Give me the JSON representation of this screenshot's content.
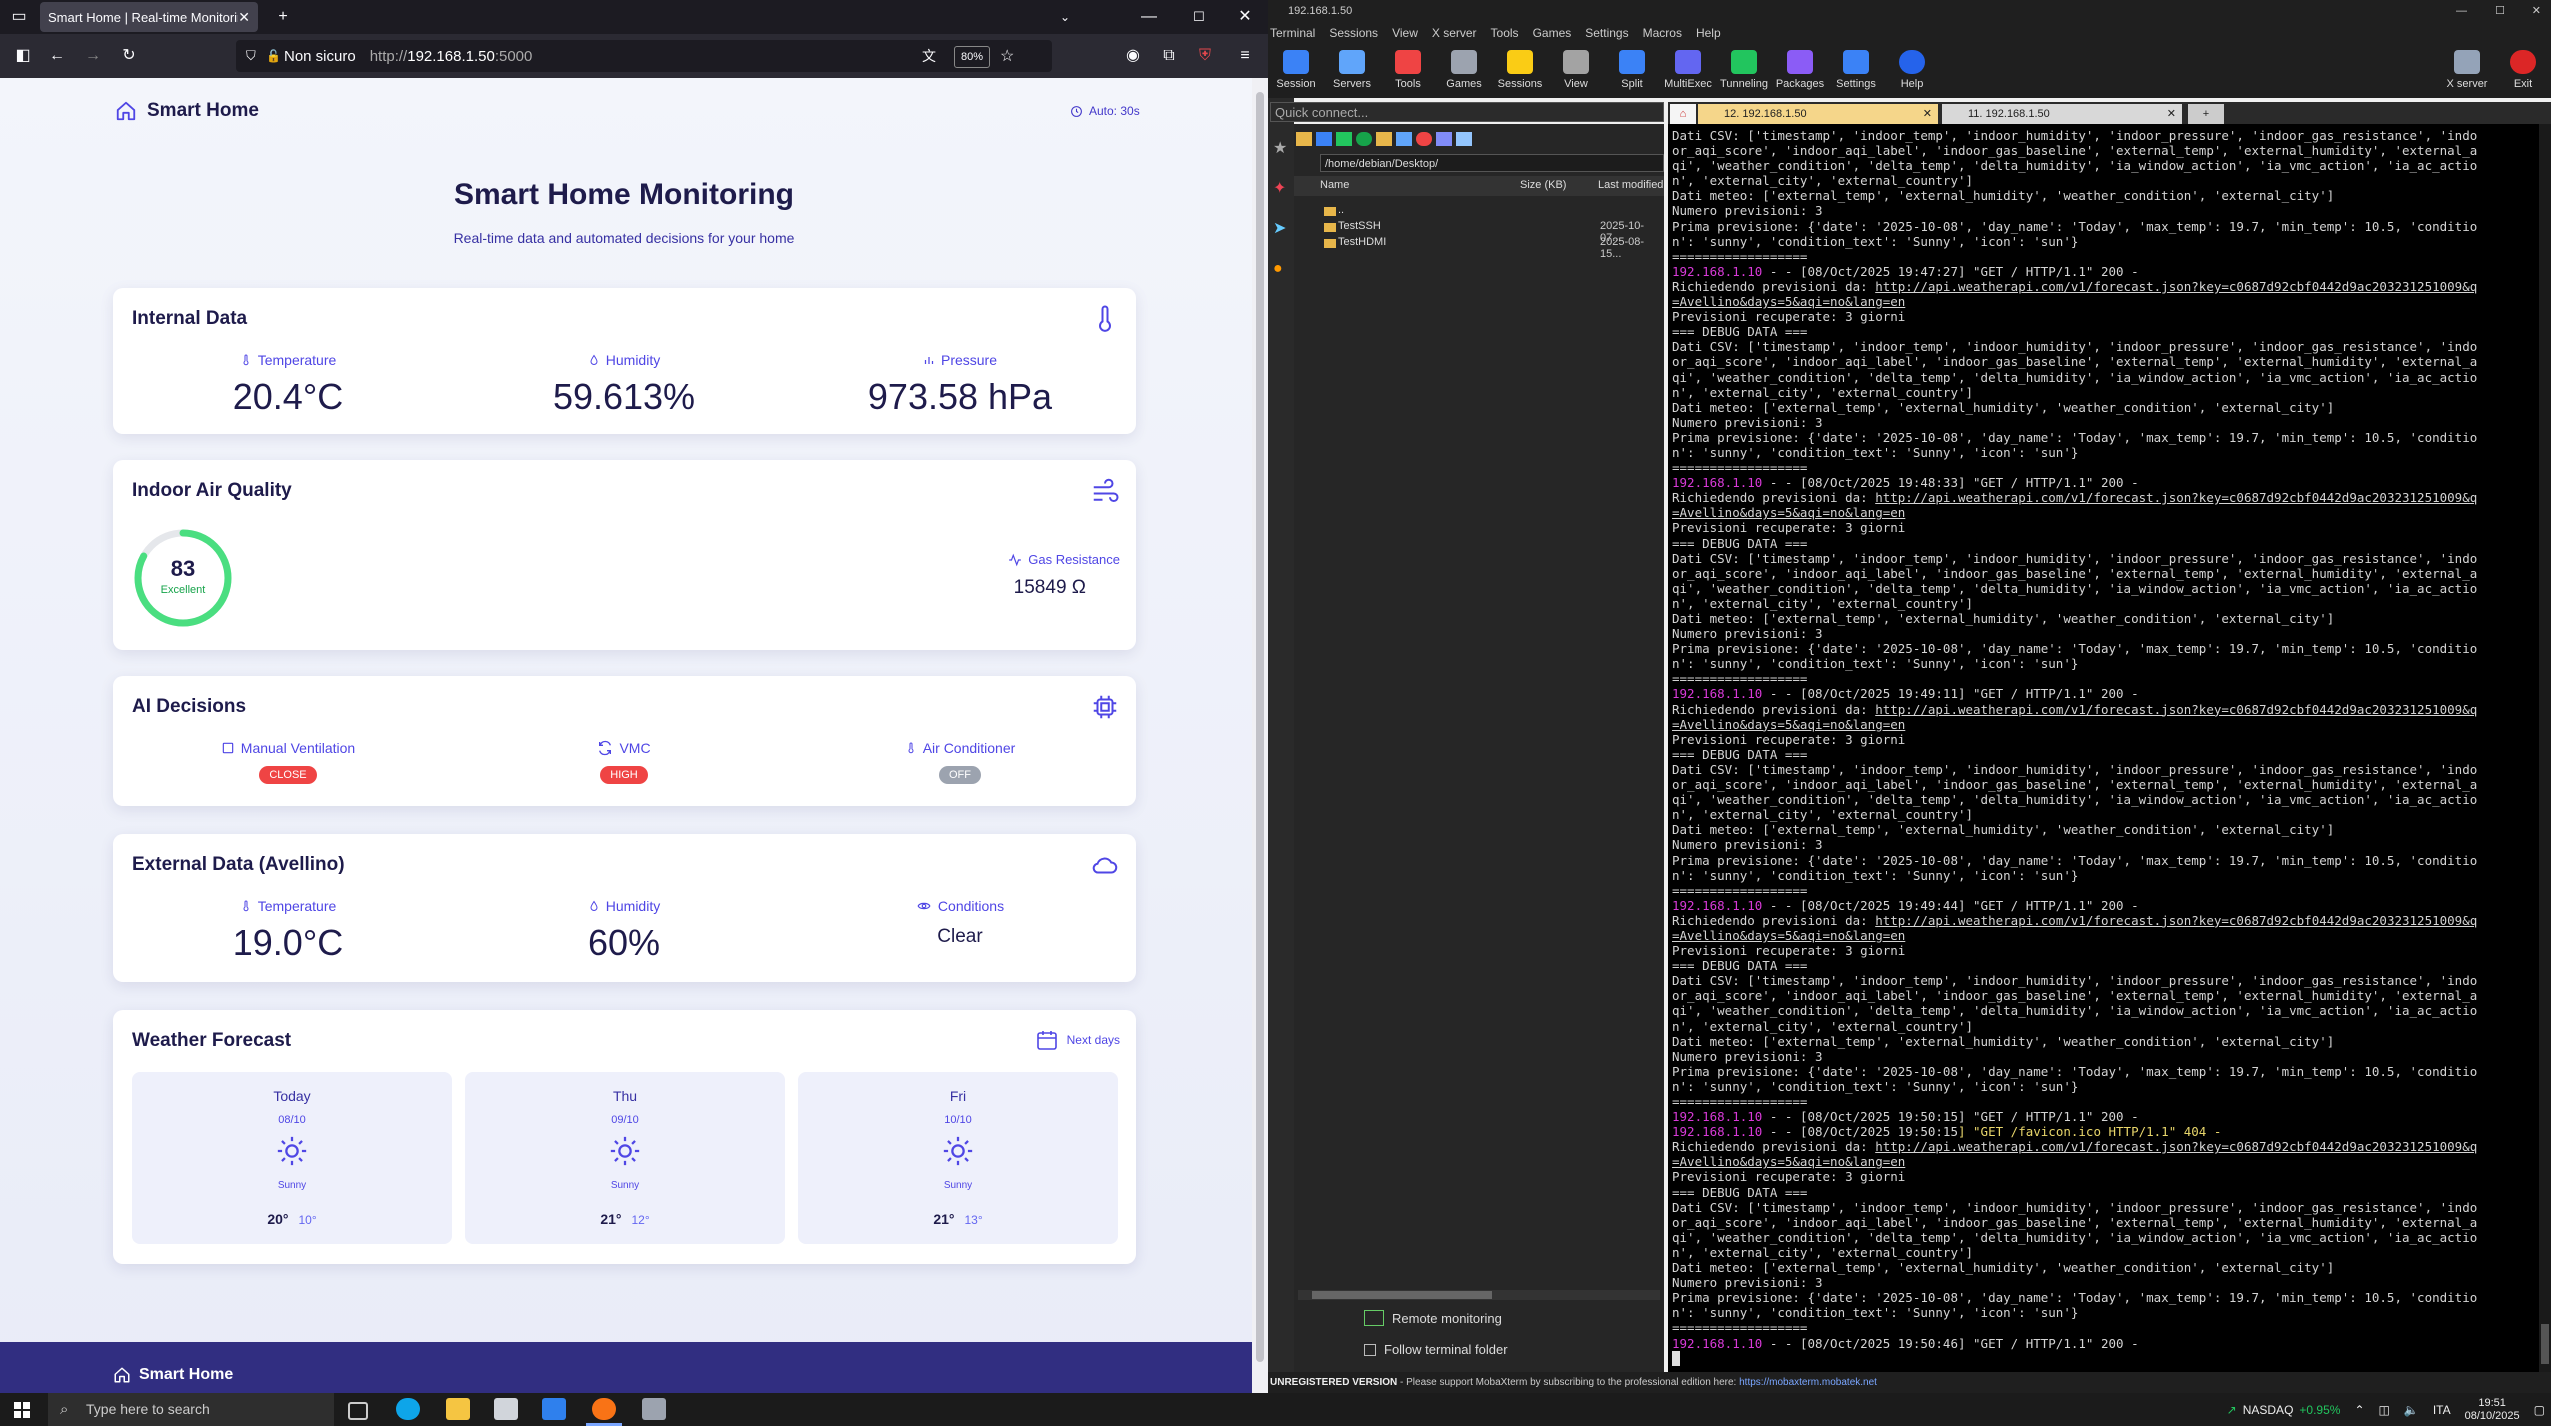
{
  "browser": {
    "tab_title": "Smart Home | Real-time Monitoring",
    "security_label": "Non sicuro",
    "url_prefix": "http://",
    "url_host": "192.168.1.50",
    "url_port": ":5000",
    "zoom": "80%"
  },
  "site": {
    "brand": "Smart Home",
    "auto_refresh": "Auto: 30s",
    "title": "Smart Home Monitoring",
    "subtitle": "Real-time data and automated decisions for your home",
    "internal": {
      "title": "Internal Data",
      "temperature_label": "Temperature",
      "temperature_value": "20.4°C",
      "humidity_label": "Humidity",
      "humidity_value": "59.613%",
      "pressure_label": "Pressure",
      "pressure_value": "973.58 hPa"
    },
    "air": {
      "title": "Indoor Air Quality",
      "aqi_score": "83",
      "aqi_fraction": 0.83,
      "aqi_label": "Excellent",
      "gas_label": "Gas Resistance",
      "gas_value": "15849 Ω"
    },
    "ai": {
      "title": "AI Decisions",
      "window_label": "Manual Ventilation",
      "window_state": "CLOSE",
      "vmc_label": "VMC",
      "vmc_state": "HIGH",
      "ac_label": "Air Conditioner",
      "ac_state": "OFF"
    },
    "external": {
      "title": "External Data (Avellino)",
      "temperature_label": "Temperature",
      "temperature_value": "19.0°C",
      "humidity_label": "Humidity",
      "humidity_value": "60%",
      "conditions_label": "Conditions",
      "conditions_value": "Clear"
    },
    "forecast": {
      "title": "Weather Forecast",
      "subtitle": "Next days",
      "days": [
        {
          "day": "Today",
          "date": "08/10",
          "condition": "Sunny",
          "max": "20°",
          "min": "10°"
        },
        {
          "day": "Thu",
          "date": "09/10",
          "condition": "Sunny",
          "max": "21°",
          "min": "12°"
        },
        {
          "day": "Fri",
          "date": "10/10",
          "condition": "Sunny",
          "max": "21°",
          "min": "13°"
        }
      ]
    },
    "footer_brand": "Smart Home"
  },
  "moba": {
    "window_title": "192.168.1.50",
    "menu": [
      "Terminal",
      "Sessions",
      "View",
      "X server",
      "Tools",
      "Games",
      "Settings",
      "Macros",
      "Help"
    ],
    "toolbar": [
      "Session",
      "Servers",
      "Tools",
      "Games",
      "Sessions",
      "View",
      "Split",
      "MultiExec",
      "Tunneling",
      "Packages",
      "Settings",
      "Help"
    ],
    "toolbar_right": [
      "X server",
      "Exit"
    ],
    "quick_connect": "Quick connect...",
    "sftp_path": "/home/debian/Desktop/",
    "sftp_headers": [
      "Name",
      "Size (KB)",
      "Last modified"
    ],
    "files": [
      {
        "name": "..",
        "modified": ""
      },
      {
        "name": "TestSSH",
        "modified": "2025-10-07..."
      },
      {
        "name": "TestHDMI",
        "modified": "2025-08-15..."
      }
    ],
    "remote_monitoring": "Remote monitoring",
    "follow_folder": "Follow terminal folder",
    "tabs": [
      "12. 192.168.1.50",
      "11. 192.168.1.50"
    ],
    "status_unregistered": "UNREGISTERED VERSION",
    "status_text": " -  Please support MobaXterm by subscribing to the professional edition here: ",
    "status_link": "https://mobaxterm.mobatek.net",
    "terminal": {
      "csv_1": "Dati CSV: ['timestamp', 'indoor_temp', 'indoor_humidity', 'indoor_pressure', 'indoor_gas_resistance', 'indo",
      "csv_2": "or_aqi_score', 'indoor_aqi_label', 'indoor_gas_baseline', 'external_temp', 'external_humidity', 'external_a",
      "csv_3": "qi', 'weather_condition', 'delta_temp', 'delta_humidity', 'ia_window_action', 'ia_vmc_action', 'ia_ac_actio",
      "csv_4": "n', 'external_city', 'external_country']",
      "meteo": "Dati meteo: ['external_temp', 'external_humidity', 'weather_condition', 'external_city']",
      "count": "Numero previsioni: 3",
      "first_1": "Prima previsione: {'date': '2025-10-08', 'day_name': 'Today', 'max_temp': 19.7, 'min_temp': 10.5, 'conditio",
      "first_2": "n': 'sunny', 'condition_text': 'Sunny', 'icon': 'sun'}",
      "sep": "==================",
      "ip": "192.168.1.10",
      "req_mid": " - - [08/Oct/2025 ",
      "req_tail": "] \"GET / HTTP/1.1\" 200 -",
      "fav_tail": "] \"GET /favicon.ico HTTP/1.1\" 404 -",
      "fetch_prefix": "Richiedendo previsioni da: ",
      "fetch_url_1": "http://api.weatherapi.com/v1/forecast.json?key=c0687d92cbf0442d9ac203231251009&q",
      "fetch_url_2": "=Avellino&days=5&aqi=no&lang=en",
      "retrieved": "Previsioni recuperate: 3 giorni",
      "debug": "=== DEBUG DATA ===",
      "times": [
        "19:47:27",
        "19:48:33",
        "19:49:11",
        "19:49:44",
        "19:50:15"
      ],
      "last_time": "19:50:46"
    }
  },
  "taskbar": {
    "search_placeholder": "Type here to search",
    "ticker": "NASDAQ",
    "ticker_change": "+0.95%",
    "lang": "ITA",
    "time": "19:51",
    "date": "08/10/2025"
  },
  "colors": {
    "accent": "#4f46e5",
    "navy": "#1e1b4b",
    "aqi_ring": "#4ade80",
    "close_badge": "#ef4444",
    "off_badge": "#9ca3af"
  }
}
